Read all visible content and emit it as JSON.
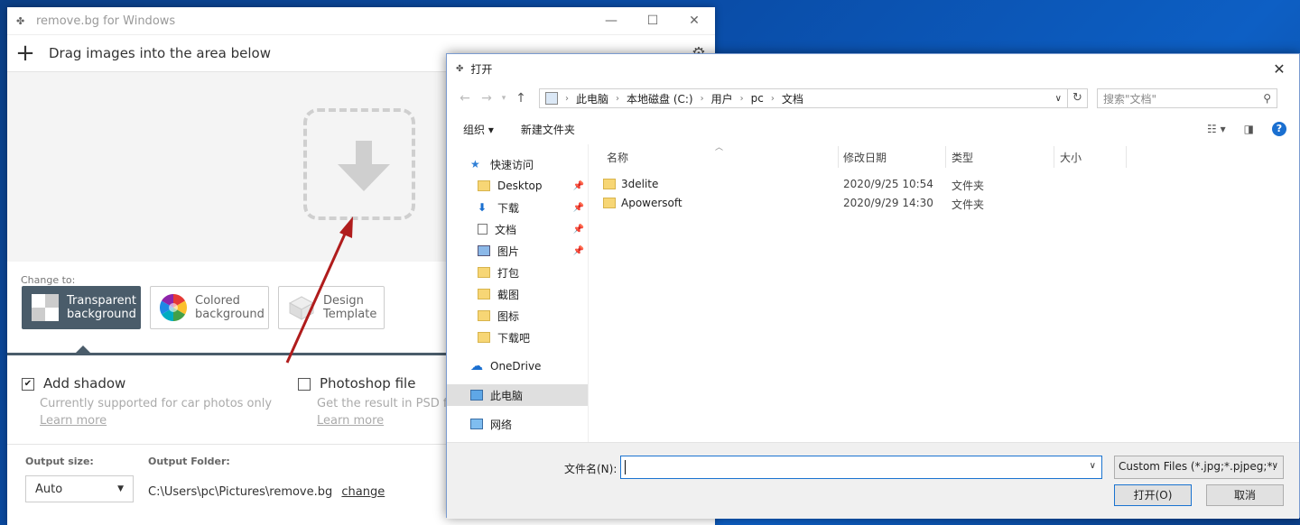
{
  "removebg": {
    "title": "remove.bg for Windows",
    "drag_text": "Drag images into the area below",
    "change_to": "Change to:",
    "options": [
      {
        "line1": "Transparent",
        "line2": "background"
      },
      {
        "line1": "Colored",
        "line2": "background"
      },
      {
        "line1": "Design",
        "line2": "Template"
      }
    ],
    "shadow": {
      "label": "Add shadow",
      "sub": "Currently supported for car photos only",
      "learn": "Learn more",
      "checked": true
    },
    "photoshop": {
      "label": "Photoshop file",
      "sub": "Get the result in PSD for",
      "learn": "Learn more",
      "checked": false
    },
    "output_size_label": "Output size:",
    "output_size_value": "Auto",
    "output_folder_label": "Output Folder:",
    "output_folder_path": "C:\\Users\\pc\\Pictures\\remove.bg",
    "change_link": "change"
  },
  "dialog": {
    "title": "打开",
    "breadcrumb": [
      "此电脑",
      "本地磁盘 (C:)",
      "用户",
      "pc",
      "文档"
    ],
    "search_placeholder": "搜索\"文档\"",
    "organize": "组织",
    "new_folder": "新建文件夹",
    "nav": [
      {
        "label": "快速访问",
        "icon": "star-icon"
      },
      {
        "label": "Desktop",
        "icon": "folder-icon",
        "pinned": true
      },
      {
        "label": "下载",
        "icon": "download-icon",
        "pinned": true
      },
      {
        "label": "文档",
        "icon": "document-icon",
        "pinned": true
      },
      {
        "label": "图片",
        "icon": "picture-icon",
        "pinned": true
      },
      {
        "label": "打包",
        "icon": "folder-icon"
      },
      {
        "label": "截图",
        "icon": "folder-icon"
      },
      {
        "label": "图标",
        "icon": "folder-icon"
      },
      {
        "label": "下载吧",
        "icon": "folder-icon"
      },
      {
        "label": "OneDrive",
        "icon": "cloud-icon"
      },
      {
        "label": "此电脑",
        "icon": "computer-icon",
        "selected": true
      },
      {
        "label": "网络",
        "icon": "network-icon"
      }
    ],
    "columns": [
      "名称",
      "修改日期",
      "类型",
      "大小"
    ],
    "files": [
      {
        "name": "3delite",
        "date": "2020/9/25 10:54",
        "type": "文件夹"
      },
      {
        "name": "Apowersoft",
        "date": "2020/9/29 14:30",
        "type": "文件夹"
      }
    ],
    "filename_label": "文件名(N):",
    "filename_value": "",
    "filetype": "Custom Files (*.jpg;*.pjpeg;*.",
    "open_button": "打开(O)",
    "cancel_button": "取消"
  },
  "colors": {
    "accent_dark": "#4a5c6a",
    "annotation_arrow": "#b01c1c",
    "selection": "#1a73d0"
  }
}
